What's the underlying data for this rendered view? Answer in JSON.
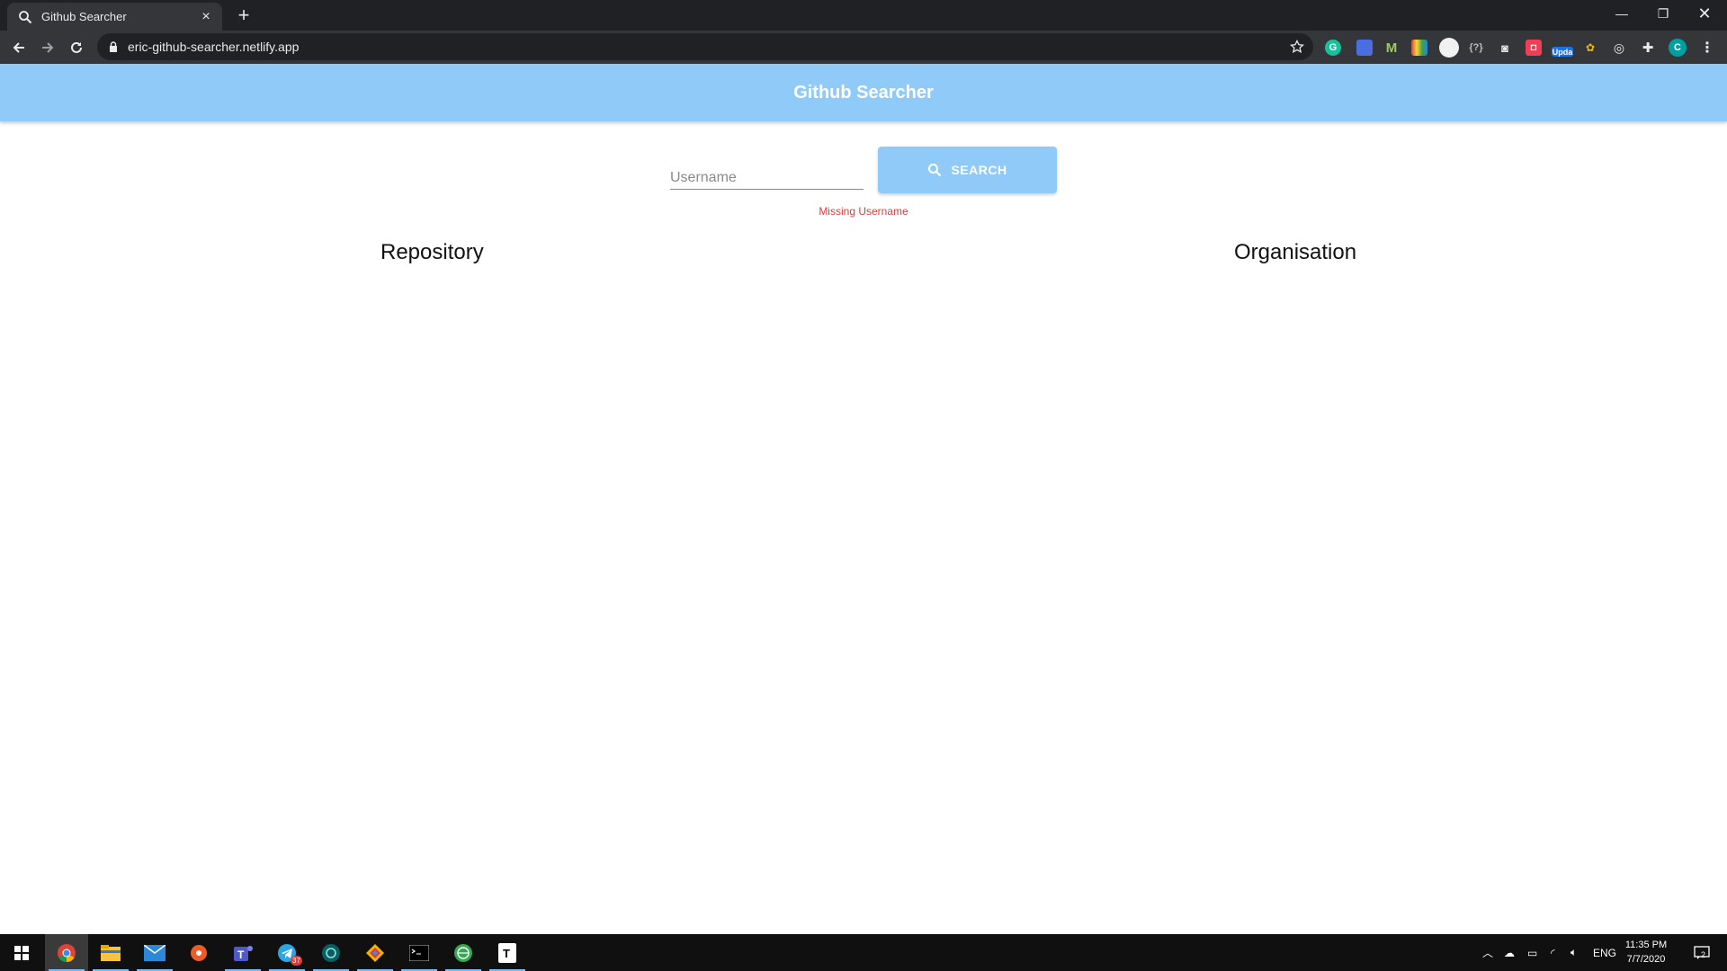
{
  "browser": {
    "tab_title": "Github Searcher",
    "url": "eric-github-searcher.netlify.app",
    "profile_initial": "C",
    "extension_badge": "Upda"
  },
  "app": {
    "title": "Github Searcher",
    "search": {
      "placeholder": "Username",
      "value": "",
      "button_label": "SEARCH",
      "error_text": "Missing Username"
    },
    "columns": {
      "left_heading": "Repository",
      "right_heading": "Organisation"
    },
    "colors": {
      "appbar": "#90caf9",
      "button": "#90caf9",
      "error": "#e53935"
    }
  },
  "taskbar": {
    "language": "ENG",
    "time": "11:35 PM",
    "date": "7/7/2020",
    "telegram_badge": "37",
    "notification_count": "2"
  }
}
